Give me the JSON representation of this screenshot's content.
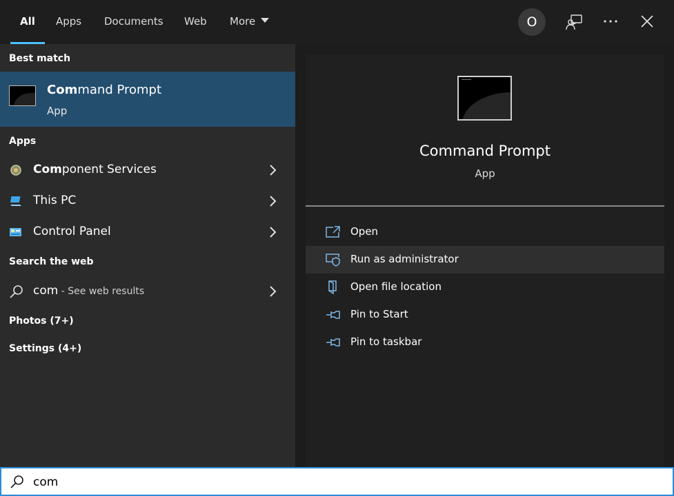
{
  "tabs": [
    {
      "label": "All"
    },
    {
      "label": "Apps"
    },
    {
      "label": "Documents"
    },
    {
      "label": "Web"
    },
    {
      "label": "More"
    }
  ],
  "avatar": {
    "initial": "O"
  },
  "icons": {
    "feedback": "feedback-icon",
    "more": "ellipsis-icon",
    "close": "close-icon"
  },
  "left": {
    "best_match_title": "Best match",
    "best_match": {
      "name_bold": "Com",
      "name_rest": "mand Prompt",
      "type": "App"
    },
    "apps_title": "Apps",
    "apps": [
      {
        "name_bold": "Com",
        "name_rest": "ponent Services",
        "icon": "component-services-icon"
      },
      {
        "name_bold": "",
        "name_rest": "This PC",
        "icon": "this-pc-icon"
      },
      {
        "name_bold": "",
        "name_rest": "Control Panel",
        "icon": "control-panel-icon"
      }
    ],
    "web_title": "Search the web",
    "web": {
      "query": "com",
      "hint": " - See web results"
    },
    "photos": "Photos (7+)",
    "settings": "Settings (4+)"
  },
  "right": {
    "title": "Command Prompt",
    "type": "App",
    "actions": [
      {
        "label": "Open",
        "icon": "open-icon"
      },
      {
        "label": "Run as administrator",
        "icon": "shield-admin-icon"
      },
      {
        "label": "Open file location",
        "icon": "folder-location-icon"
      },
      {
        "label": "Pin to Start",
        "icon": "pin-icon"
      },
      {
        "label": "Pin to taskbar",
        "icon": "pin-icon"
      }
    ]
  },
  "search": {
    "value": "com"
  },
  "colors": {
    "accent": "#4cc2ff",
    "selection": "#234e6e",
    "search_border": "#2b8bd6"
  }
}
